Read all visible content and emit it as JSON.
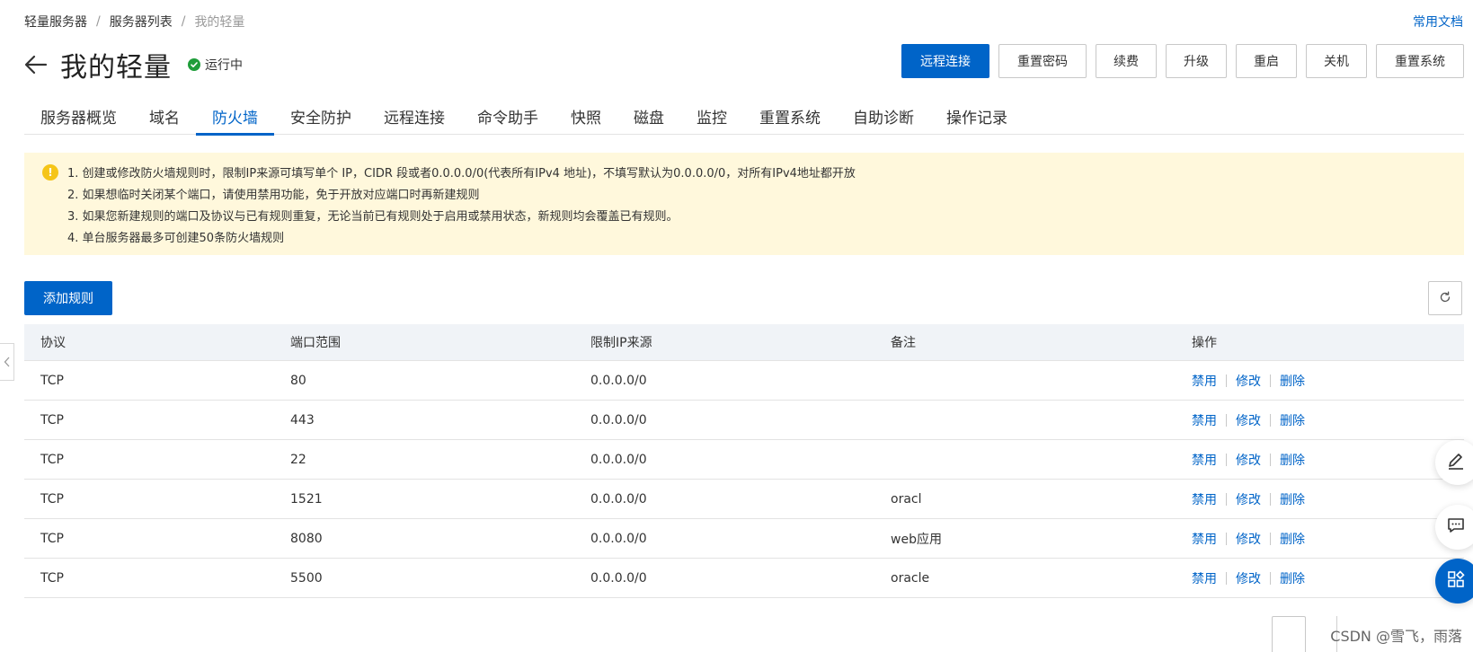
{
  "breadcrumb": {
    "items": [
      "轻量服务器",
      "服务器列表",
      "我的轻量"
    ],
    "separator": "/"
  },
  "doc_link": "常用文档",
  "page": {
    "title": "我的轻量",
    "status": "运行中",
    "status_color": "#1f9d3a"
  },
  "actions": {
    "remote_connect": "远程连接",
    "reset_password": "重置密码",
    "renew": "续费",
    "upgrade": "升级",
    "restart": "重启",
    "shutdown": "关机",
    "reset_system": "重置系统"
  },
  "tabs": [
    {
      "label": "服务器概览"
    },
    {
      "label": "域名"
    },
    {
      "label": "防火墙"
    },
    {
      "label": "安全防护"
    },
    {
      "label": "远程连接"
    },
    {
      "label": "命令助手"
    },
    {
      "label": "快照"
    },
    {
      "label": "磁盘"
    },
    {
      "label": "监控"
    },
    {
      "label": "重置系统"
    },
    {
      "label": "自助诊断"
    },
    {
      "label": "操作记录"
    }
  ],
  "active_tab": "防火墙",
  "notice": {
    "icon": "warning-icon",
    "lines": [
      "1. 创建或修改防火墙规则时，限制IP来源可填写单个 IP，CIDR 段或者0.0.0.0/0(代表所有IPv4 地址)，不填写默认为0.0.0.0/0，对所有IPv4地址都开放",
      "2. 如果想临时关闭某个端口，请使用禁用功能，免于开放对应端口时再新建规则",
      "3. 如果您新建规则的端口及协议与已有规则重复，无论当前已有规则处于启用或禁用状态，新规则均会覆盖已有规则。",
      "4. 单台服务器最多可创建50条防火墙规则"
    ]
  },
  "toolbar": {
    "add_rule": "添加规则",
    "refresh_icon": "refresh-icon"
  },
  "table": {
    "headers": [
      "协议",
      "端口范围",
      "限制IP来源",
      "备注",
      "操作"
    ],
    "rows": [
      {
        "protocol": "TCP",
        "port": "80",
        "source": "0.0.0.0/0",
        "note": ""
      },
      {
        "protocol": "TCP",
        "port": "443",
        "source": "0.0.0.0/0",
        "note": ""
      },
      {
        "protocol": "TCP",
        "port": "22",
        "source": "0.0.0.0/0",
        "note": ""
      },
      {
        "protocol": "TCP",
        "port": "1521",
        "source": "0.0.0.0/0",
        "note": "oracl"
      },
      {
        "protocol": "TCP",
        "port": "8080",
        "source": "0.0.0.0/0",
        "note": "web应用"
      },
      {
        "protocol": "TCP",
        "port": "5500",
        "source": "0.0.0.0/0",
        "note": "oracle"
      }
    ],
    "ops": {
      "disable": "禁用",
      "edit": "修改",
      "delete": "删除"
    }
  },
  "watermark": "CSDN @雪飞，雨落",
  "colors": {
    "primary": "#0064c8",
    "notice_bg": "#fff8dc",
    "header_bg": "#f0f3f7"
  }
}
